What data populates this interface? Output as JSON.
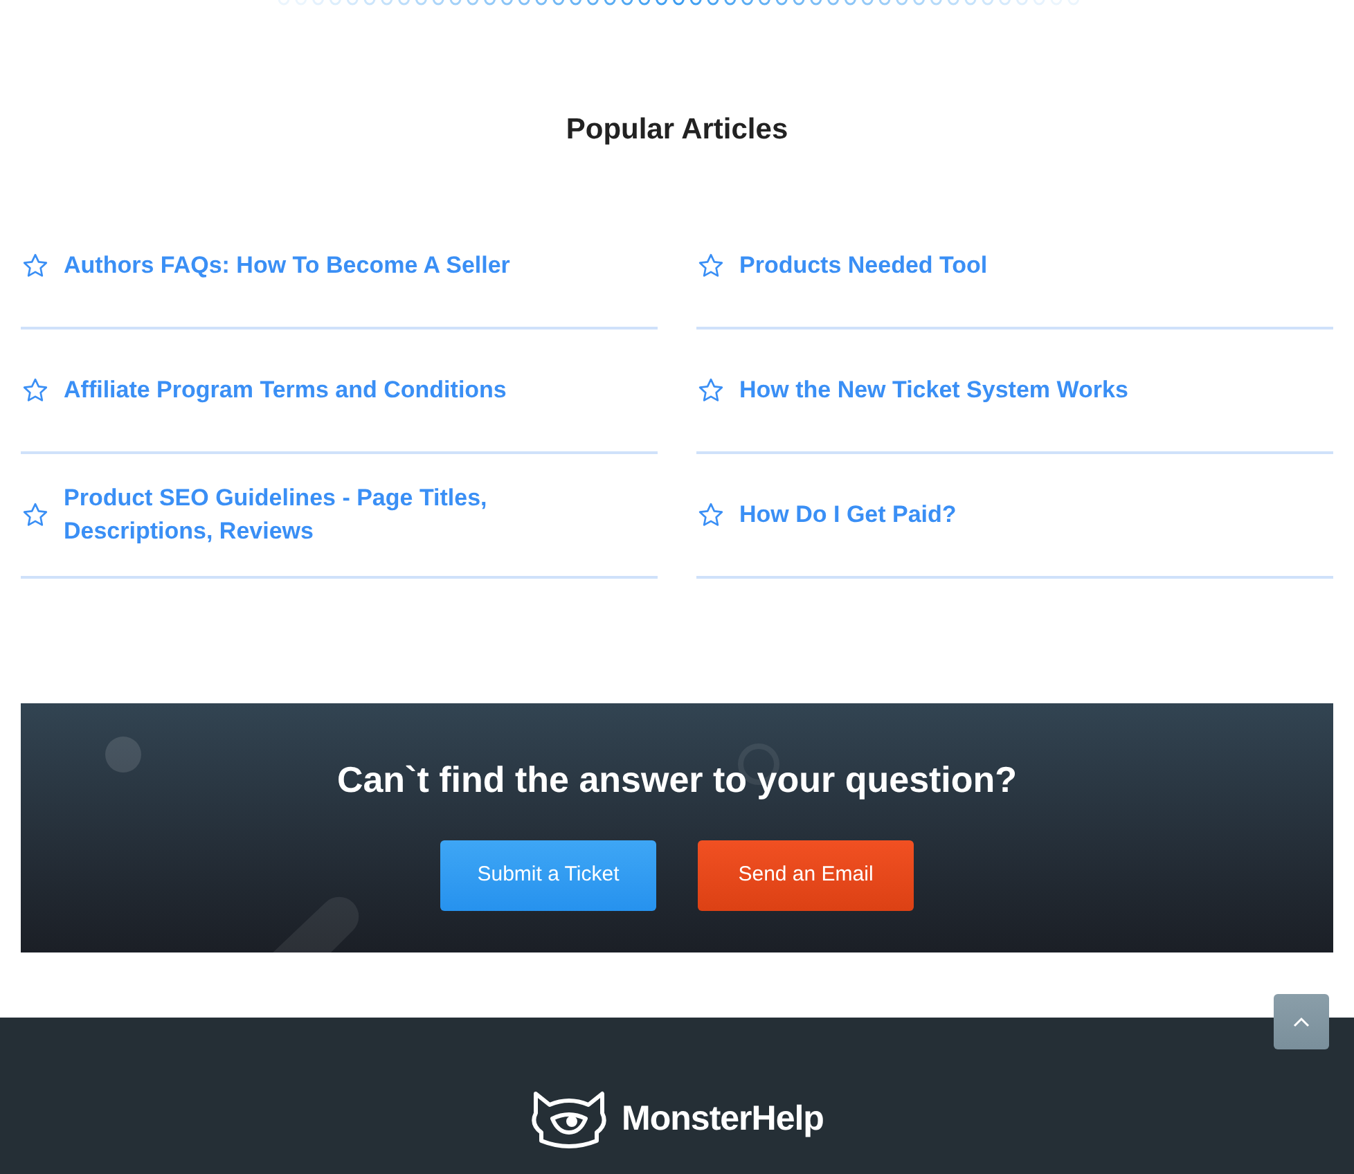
{
  "popular_articles": {
    "title": "Popular Articles",
    "articles": [
      {
        "title": "Authors FAQs: How To Become A Seller"
      },
      {
        "title": "Products Needed Tool"
      },
      {
        "title": "Affiliate Program Terms and Conditions"
      },
      {
        "title": "How the New Ticket System Works"
      },
      {
        "title": "Product SEO Guidelines - Page Titles, Descriptions, Reviews"
      },
      {
        "title": "How Do I Get Paid?"
      }
    ]
  },
  "help_banner": {
    "heading": "Can`t find the answer to your question?",
    "buttons": [
      {
        "label": "Submit a Ticket",
        "kind": "primary"
      },
      {
        "label": "Send an Email",
        "kind": "danger"
      }
    ]
  },
  "footer": {
    "logo_text": "MonsterHelp"
  }
}
